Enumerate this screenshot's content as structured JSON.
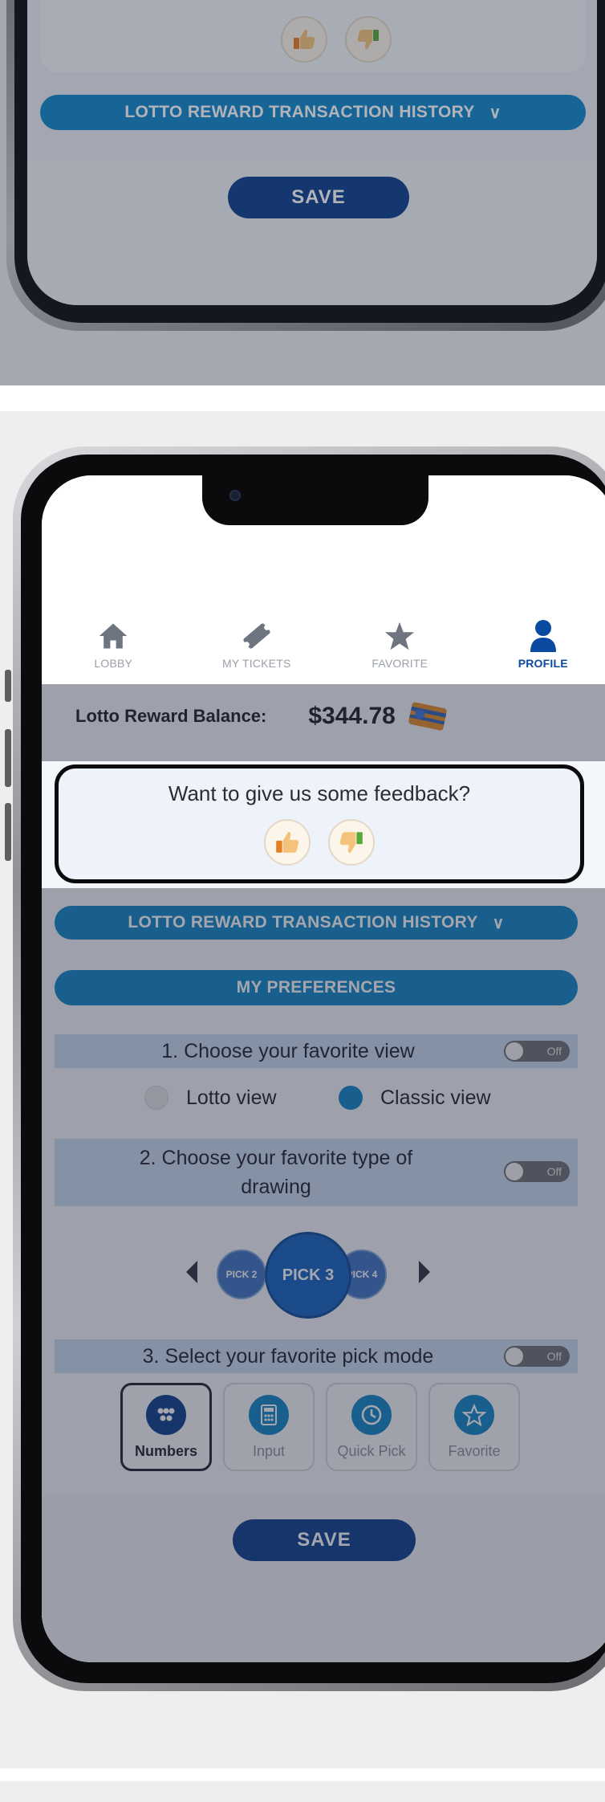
{
  "top_panel": {
    "history_label": "LOTTO REWARD TRANSACTION HISTORY",
    "save_label": "SAVE"
  },
  "nav": {
    "items": [
      {
        "label": "LOBBY",
        "icon": "home-icon"
      },
      {
        "label": "MY TICKETS",
        "icon": "ticket-icon"
      },
      {
        "label": "FAVORITE",
        "icon": "star-icon"
      },
      {
        "label": "PROFILE",
        "icon": "profile-icon",
        "active": true
      }
    ]
  },
  "balance": {
    "label": "Lotto Reward Balance:",
    "value": "$344.78"
  },
  "feedback": {
    "title": "Want to give us some feedback?"
  },
  "history": {
    "label": "LOTTO REWARD TRANSACTION HISTORY"
  },
  "preferences": {
    "header": "MY PREFERENCES",
    "pref1": {
      "label": "1. Choose your favorite view",
      "toggle": "Off"
    },
    "views": [
      {
        "label": "Lotto view",
        "selected": false
      },
      {
        "label": "Classic view",
        "selected": true
      }
    ],
    "pref2": {
      "label": "2. Choose your favorite type of drawing",
      "toggle": "Off"
    },
    "games": [
      "PICK 2",
      "PICK 3",
      "PICK 4"
    ],
    "pref3": {
      "label": "3. Select your favorite pick mode",
      "toggle": "Off"
    },
    "modes": [
      {
        "label": "Numbers",
        "icon": "dots-icon",
        "selected": true
      },
      {
        "label": "Input",
        "icon": "calculator-icon",
        "selected": false
      },
      {
        "label": "Quick Pick",
        "icon": "clock-icon",
        "selected": false
      },
      {
        "label": "Favorite",
        "icon": "star-icon",
        "selected": false
      }
    ]
  },
  "save_label": "SAVE",
  "colors": {
    "accent": "#0e86c9",
    "save": "#0a3e8d",
    "profile_active": "#0a4aa1",
    "pref_bar": "#c9dbf2"
  }
}
